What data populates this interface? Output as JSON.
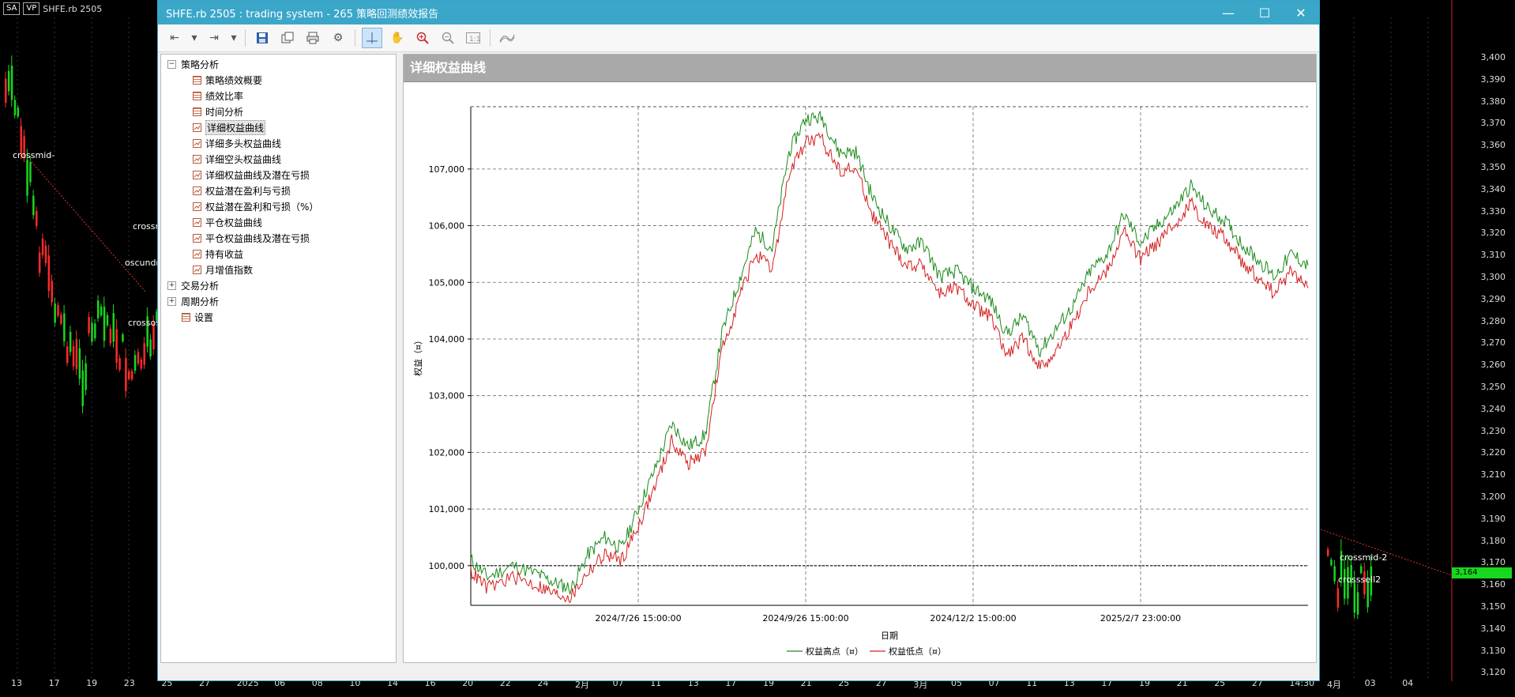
{
  "background": {
    "toolbar": {
      "symbol_box": "SA",
      "vp_box": "VP",
      "symbol": "SHFE.rb 2505"
    },
    "price_axis": [
      "3,400",
      "3,390",
      "3,380",
      "3,370",
      "3,360",
      "3,350",
      "3,340",
      "3,330",
      "3,320",
      "3,310",
      "3,300",
      "3,290",
      "3,280",
      "3,270",
      "3,260",
      "3,250",
      "3,240",
      "3,230",
      "3,220",
      "3,210",
      "3,200",
      "3,190",
      "3,180",
      "3,170",
      "3,160",
      "3,150",
      "3,140",
      "3,130",
      "3,120"
    ],
    "last_price": "3,164",
    "date_axis": [
      "13",
      "17",
      "19",
      "23",
      "25",
      "27",
      "2025",
      "06",
      "08",
      "10",
      "14",
      "16",
      "20",
      "22",
      "24",
      "2月",
      "07",
      "11",
      "13",
      "17",
      "19",
      "21",
      "25",
      "27",
      "3月",
      "05",
      "07",
      "11",
      "13",
      "17",
      "19",
      "21",
      "25",
      "27",
      "14:30",
      "4月",
      "03",
      "04"
    ],
    "annotations": [
      "crossmid-",
      "crossm",
      "oscundm",
      "crossos",
      "crossmid-2",
      "crosssell2"
    ],
    "colors": {
      "up_candle": "#17d81e",
      "down_candle": "#ff2a2a",
      "axis": "#ddd",
      "last_price_bg": "#17d81e"
    }
  },
  "window": {
    "title": "SHFE.rb 2505 : trading system - 265 策略回测绩效报告",
    "controls": {
      "minimize": "—",
      "maximize": "☐",
      "close": "✕"
    }
  },
  "toolbar_icons": [
    "back-icon",
    "dropdown-icon",
    "forward-icon",
    "dropdown-icon",
    "save-icon",
    "copy-icon",
    "print-icon",
    "settings-icon",
    "crosshair-icon",
    "hand-icon",
    "zoom-in-icon",
    "zoom-out-icon",
    "actual-size-icon",
    "chart-style-icon"
  ],
  "tree": {
    "groups": [
      {
        "label": "策略分析",
        "expanded": true,
        "items": [
          {
            "label": "策略绩效概要",
            "icon": "table"
          },
          {
            "label": "绩效比率",
            "icon": "table"
          },
          {
            "label": "时间分析",
            "icon": "table"
          },
          {
            "label": "详细权益曲线",
            "icon": "chart",
            "selected": true
          },
          {
            "label": "详细多头权益曲线",
            "icon": "chart"
          },
          {
            "label": "详细空头权益曲线",
            "icon": "chart"
          },
          {
            "label": "详细权益曲线及潜在亏损",
            "icon": "chart"
          },
          {
            "label": "权益潜在盈利与亏损",
            "icon": "chart"
          },
          {
            "label": "权益潜在盈利和亏损（%）",
            "icon": "chart"
          },
          {
            "label": "平仓权益曲线",
            "icon": "chart"
          },
          {
            "label": "平仓权益曲线及潜在亏损",
            "icon": "chart"
          },
          {
            "label": "持有收益",
            "icon": "chart"
          },
          {
            "label": "月增值指数",
            "icon": "chart"
          }
        ]
      },
      {
        "label": "交易分析",
        "expanded": false
      },
      {
        "label": "周期分析",
        "expanded": false
      }
    ],
    "settings_label": "设置"
  },
  "panel": {
    "header": "详细权益曲线"
  },
  "chart_data": {
    "type": "line",
    "title": "",
    "xlabel": "日期",
    "ylabel": "权益（¤）",
    "ylim": [
      99300,
      108100
    ],
    "yticks": [
      100000,
      101000,
      102000,
      103000,
      104000,
      105000,
      106000,
      107000
    ],
    "ytick_labels": [
      "100,000",
      "101,000",
      "102,000",
      "103,000",
      "104,000",
      "105,000",
      "106,000",
      "107,000"
    ],
    "x_tick_labels": [
      "2024/7/26 15:00:00",
      "2024/9/26 15:00:00",
      "2024/12/2 15:00:00",
      "2025/2/7 23:00:00"
    ],
    "x_tick_positions": [
      0.2,
      0.4,
      0.6,
      0.8
    ],
    "grid": true,
    "reference_line": 100000,
    "legend_position": "bottom",
    "series": [
      {
        "name": "权益高点（¤）",
        "color": "#1a8a1a",
        "x": [
          0,
          0.02,
          0.05,
          0.08,
          0.1,
          0.12,
          0.14,
          0.16,
          0.18,
          0.2,
          0.22,
          0.24,
          0.26,
          0.28,
          0.3,
          0.32,
          0.34,
          0.36,
          0.38,
          0.4,
          0.42,
          0.44,
          0.46,
          0.48,
          0.5,
          0.52,
          0.54,
          0.56,
          0.58,
          0.6,
          0.62,
          0.64,
          0.66,
          0.68,
          0.7,
          0.72,
          0.74,
          0.76,
          0.78,
          0.8,
          0.82,
          0.84,
          0.86,
          0.88,
          0.9,
          0.92,
          0.94,
          0.96,
          0.98,
          1.0
        ],
        "values": [
          100100,
          99800,
          100000,
          99850,
          99700,
          99600,
          100200,
          100500,
          100300,
          101000,
          101700,
          102500,
          102100,
          102300,
          104100,
          105000,
          105900,
          105600,
          107300,
          107900,
          107900,
          107300,
          107300,
          106500,
          106000,
          105600,
          105700,
          105100,
          105200,
          104900,
          104700,
          104100,
          104400,
          103800,
          104200,
          104600,
          105200,
          105500,
          106200,
          105700,
          106000,
          106300,
          106700,
          106300,
          106100,
          105700,
          105400,
          105100,
          105500,
          105300
        ]
      },
      {
        "name": "权益低点（¤）",
        "color": "#d42020",
        "x": [
          0,
          0.02,
          0.05,
          0.08,
          0.1,
          0.12,
          0.14,
          0.16,
          0.18,
          0.2,
          0.22,
          0.24,
          0.26,
          0.28,
          0.3,
          0.32,
          0.34,
          0.36,
          0.38,
          0.4,
          0.42,
          0.44,
          0.46,
          0.48,
          0.5,
          0.52,
          0.54,
          0.56,
          0.58,
          0.6,
          0.62,
          0.64,
          0.66,
          0.68,
          0.7,
          0.72,
          0.74,
          0.76,
          0.78,
          0.8,
          0.82,
          0.84,
          0.86,
          0.88,
          0.9,
          0.92,
          0.94,
          0.96,
          0.98,
          1.0
        ],
        "values": [
          99900,
          99600,
          99800,
          99650,
          99500,
          99450,
          99900,
          100200,
          100100,
          100700,
          101400,
          102200,
          101800,
          102000,
          103800,
          104700,
          105500,
          105200,
          106900,
          107500,
          107500,
          107000,
          107000,
          106200,
          105700,
          105300,
          105300,
          104800,
          104900,
          104600,
          104400,
          103700,
          104000,
          103500,
          103800,
          104300,
          104900,
          105200,
          105900,
          105400,
          105700,
          106000,
          106400,
          106000,
          105800,
          105400,
          105100,
          104800,
          105200,
          104900
        ]
      }
    ]
  }
}
